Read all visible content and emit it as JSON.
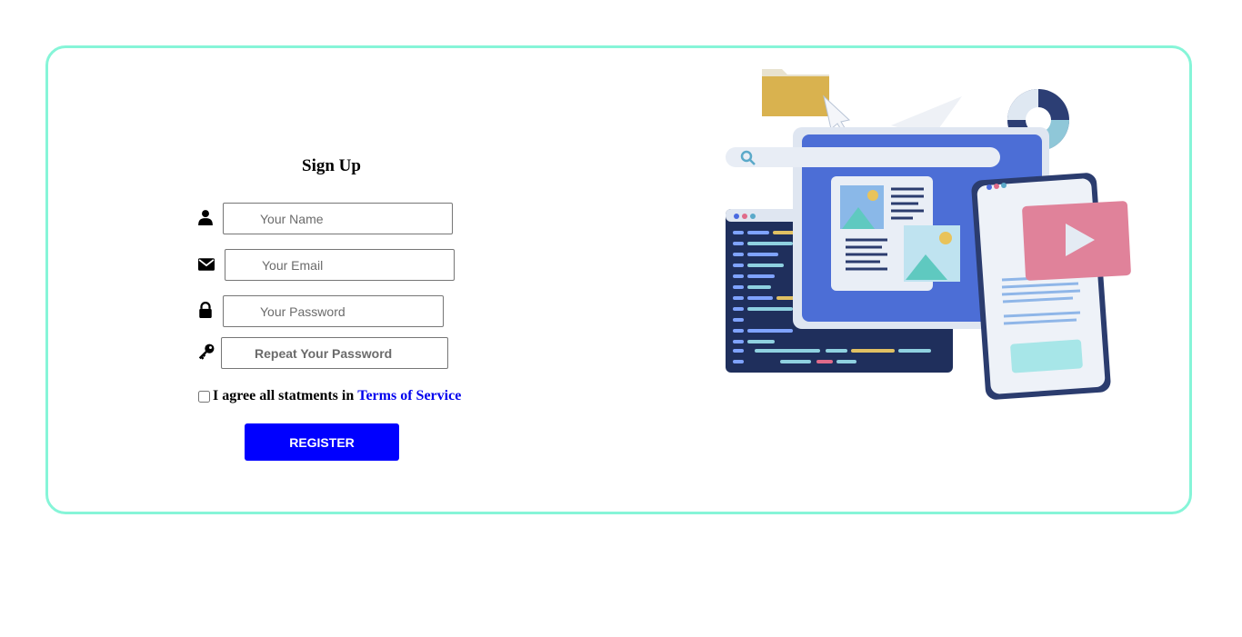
{
  "form": {
    "title": "Sign Up",
    "name_placeholder": "Your Name",
    "email_placeholder": "Your Email",
    "password_placeholder": "Your Password",
    "repeat_password_placeholder": "Repeat Your Password",
    "agree_text": "I agree all statments in",
    "terms_link": "Terms of Service",
    "register_label": "REGISTER"
  },
  "icons": {
    "name": "user-icon",
    "email": "envelope-icon",
    "password": "lock-icon",
    "repeat_password": "key-icon"
  },
  "colors": {
    "card_border": "#86f5d8",
    "register_button": "#0000ff",
    "link": "#0000ee"
  }
}
